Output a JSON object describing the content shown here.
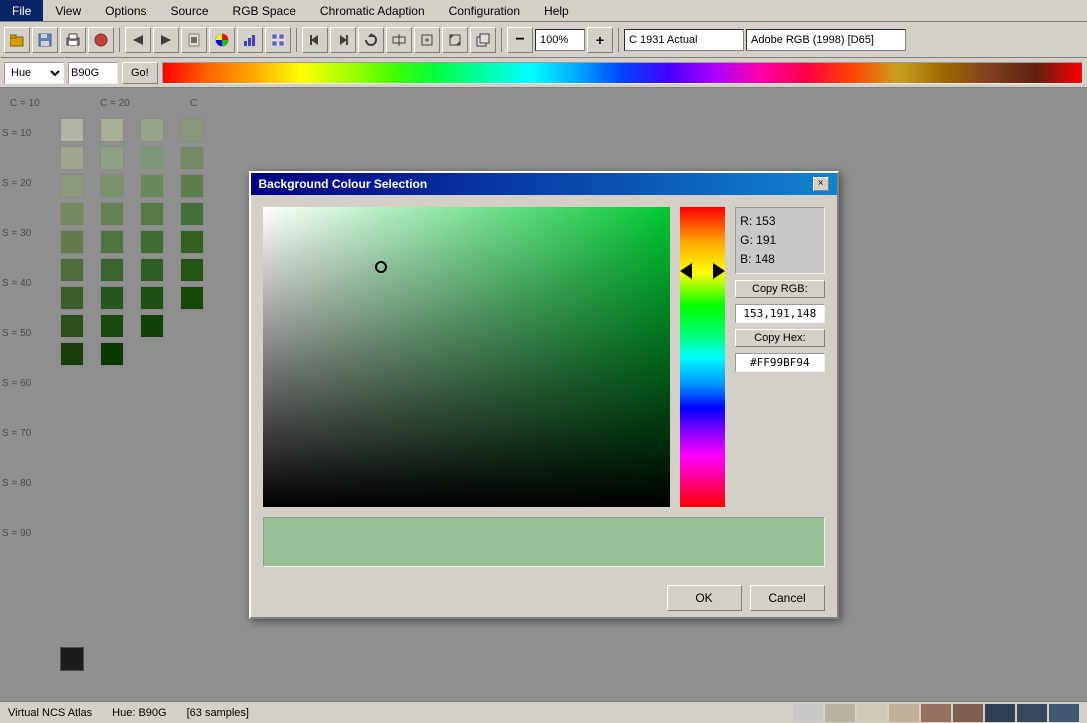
{
  "menubar": {
    "items": [
      "File",
      "View",
      "Options",
      "Source",
      "RGB Space",
      "Chromatic Adaption",
      "Configuration",
      "Help"
    ]
  },
  "toolbar": {
    "zoom_level": "100%",
    "color_mode": "C 1931 Actual",
    "color_space": "Adobe RGB (1998) [D65]"
  },
  "toolbar2": {
    "hue_type": "Hue",
    "hue_value": "B90G",
    "go_label": "Go!"
  },
  "dialog": {
    "title": "Background Colour Selection",
    "close_icon": "×",
    "rgb": {
      "r_label": "R: 153",
      "g_label": "G: 191",
      "b_label": "B: 148"
    },
    "copy_rgb_label": "Copy RGB:",
    "copy_rgb_value": "153,191,148",
    "copy_hex_label": "Copy Hex:",
    "copy_hex_value": "#FF99BF94",
    "ok_label": "OK",
    "cancel_label": "Cancel"
  },
  "status": {
    "atlas": "Virtual NCS Atlas",
    "hue": "Hue: B90G",
    "samples": "[63 samples]"
  },
  "status_swatches": [
    "#c8c8c8",
    "#d4d0c8",
    "#b8b8b8",
    "#a89080",
    "#806050",
    "#405060",
    "#304050"
  ]
}
